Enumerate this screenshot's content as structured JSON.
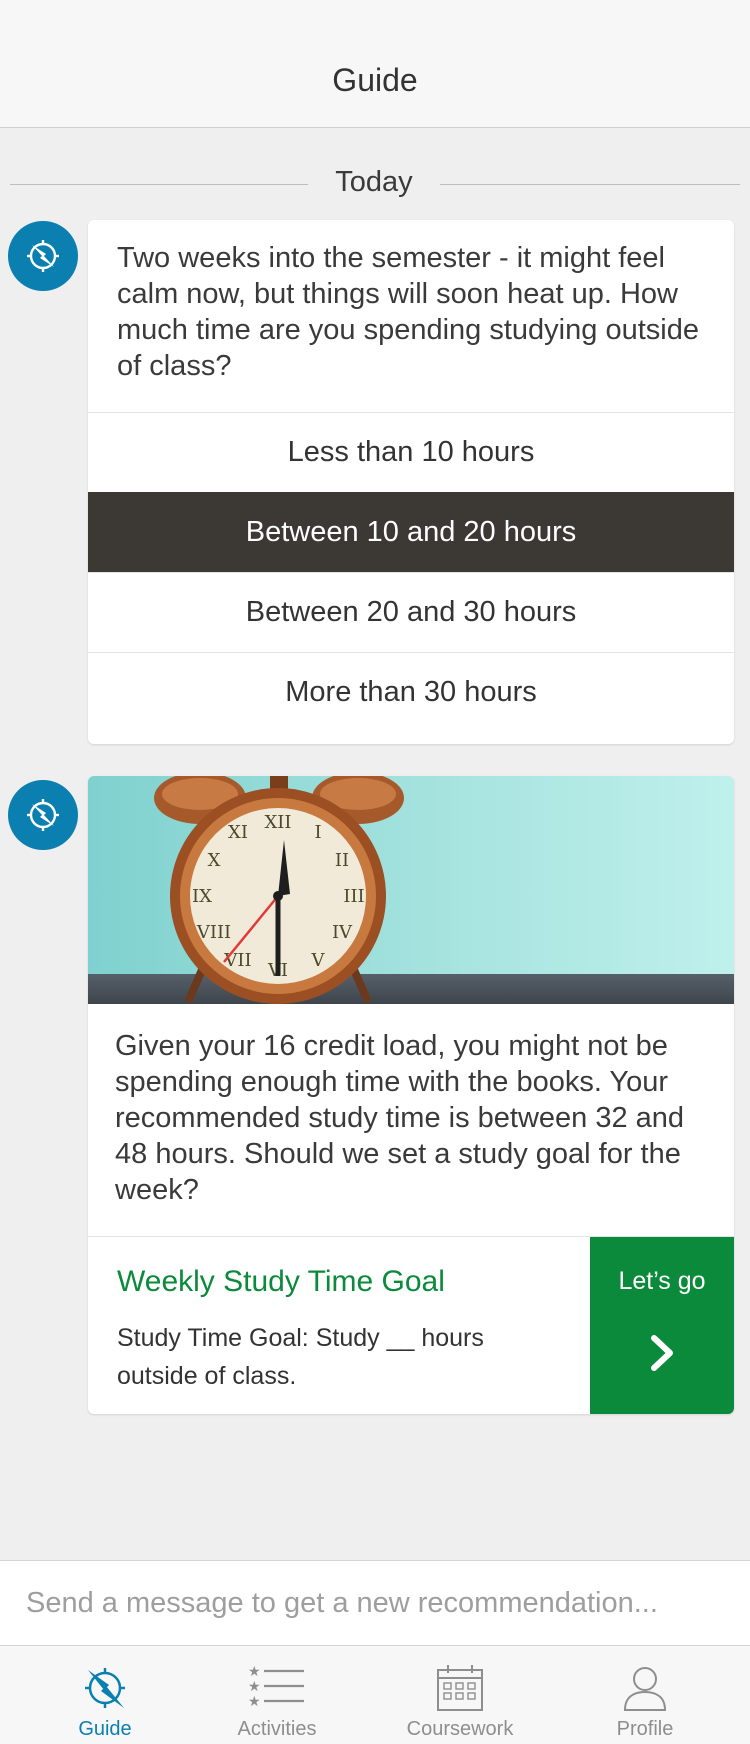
{
  "header": {
    "title": "Guide"
  },
  "divider": {
    "label": "Today"
  },
  "question_card": {
    "text": "Two weeks into the semester - it might feel calm now, but things will soon heat up. How much time are you spending studying outside of class?",
    "options": [
      {
        "label": "Less than 10 hours"
      },
      {
        "label": "Between 10 and 20 hours"
      },
      {
        "label": "Between 20 and 30 hours"
      },
      {
        "label": "More than 30 hours"
      }
    ],
    "selected_index": 1
  },
  "recommendation_card": {
    "image_icon": "alarm-clock",
    "text": "Given your 16 credit load, you might not be spending enough time with the books. Your recommended study time is between 32 and 48 hours. Should we set a study goal for the week?",
    "goal_title": "Weekly Study Time Goal",
    "goal_desc": "Study Time Goal: Study __ hours outside of class.",
    "go_label": "Let’s go"
  },
  "message_bar": {
    "placeholder": "Send a message to get a new recommendation..."
  },
  "tabs": [
    {
      "label": "Guide",
      "icon": "compass-icon",
      "active": true
    },
    {
      "label": "Activities",
      "icon": "list-icon",
      "active": false
    },
    {
      "label": "Coursework",
      "icon": "calendar-icon",
      "active": false
    },
    {
      "label": "Profile",
      "icon": "person-icon",
      "active": false
    }
  ],
  "colors": {
    "accent": "#0a7fb0",
    "goal_green": "#0a8a3a",
    "selected_option": "#3c3935"
  }
}
